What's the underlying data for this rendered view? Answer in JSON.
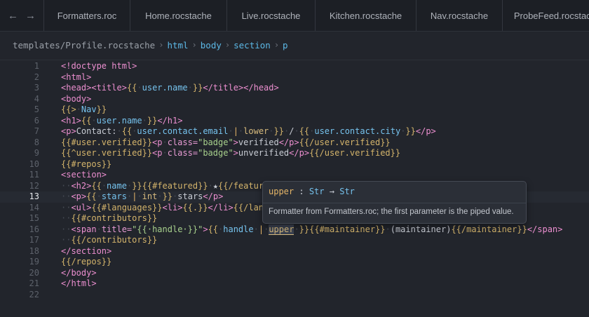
{
  "nav": {
    "back_icon": "←",
    "forward_icon": "→"
  },
  "tabs": [
    {
      "label": "Formatters.roc"
    },
    {
      "label": "Home.rocstache"
    },
    {
      "label": "Live.rocstache"
    },
    {
      "label": "Kitchen.rocstache"
    },
    {
      "label": "Nav.rocstache"
    },
    {
      "label": "ProbeFeed.rocstache"
    }
  ],
  "breadcrumb": {
    "path": "templates/Profile.rocstache",
    "sep": "›",
    "segments": [
      "html",
      "body",
      "section",
      "p"
    ]
  },
  "editor": {
    "current_line": 13,
    "lines": [
      [
        [
          "<!doctype html>",
          "tag"
        ]
      ],
      [
        [
          "<html>",
          "tag"
        ]
      ],
      [
        [
          "<head>",
          "tag"
        ],
        [
          "<title>",
          "tag"
        ],
        [
          "{{",
          "br"
        ],
        [
          "·",
          "ws"
        ],
        [
          "user.name",
          "var"
        ],
        [
          "·",
          "ws"
        ],
        [
          "}}",
          "br"
        ],
        [
          "</title>",
          "tag"
        ],
        [
          "</head>",
          "tag"
        ]
      ],
      [
        [
          "<body>",
          "tag"
        ]
      ],
      [
        [
          "{{>",
          "br"
        ],
        [
          "·",
          "ws"
        ],
        [
          "Nav",
          "var"
        ],
        [
          "}}",
          "br"
        ]
      ],
      [
        [
          "<h1>",
          "tag"
        ],
        [
          "{{",
          "br"
        ],
        [
          "·",
          "ws"
        ],
        [
          "user.name",
          "var"
        ],
        [
          "·",
          "ws"
        ],
        [
          "}}",
          "br"
        ],
        [
          "</h1>",
          "tag"
        ]
      ],
      [
        [
          "<p>",
          "tag"
        ],
        [
          "Contact:",
          "txt"
        ],
        [
          "·",
          "ws"
        ],
        [
          "{{",
          "br"
        ],
        [
          "·",
          "ws"
        ],
        [
          "user.contact.email",
          "var"
        ],
        [
          "·",
          "ws"
        ],
        [
          "|",
          "fmt"
        ],
        [
          "·",
          "ws"
        ],
        [
          "lower",
          "kw"
        ],
        [
          "·",
          "ws"
        ],
        [
          "}}",
          "br"
        ],
        [
          "·",
          "ws"
        ],
        [
          "/",
          "txt"
        ],
        [
          "·",
          "ws"
        ],
        [
          "{{",
          "br"
        ],
        [
          "·",
          "ws"
        ],
        [
          "user.contact.city",
          "var"
        ],
        [
          "·",
          "ws"
        ],
        [
          "}}",
          "br"
        ],
        [
          "</p>",
          "tag"
        ]
      ],
      [
        [
          "{{#user.verified}}",
          "br"
        ],
        [
          "<p",
          "tag"
        ],
        [
          "·",
          "ws"
        ],
        [
          "class=",
          "attr"
        ],
        [
          "\"badge\"",
          "str"
        ],
        [
          ">",
          "tag"
        ],
        [
          "verified",
          "txt"
        ],
        [
          "</p>",
          "tag"
        ],
        [
          "{{/user.verified}}",
          "br"
        ]
      ],
      [
        [
          "{{^user.verified}}",
          "br"
        ],
        [
          "<p",
          "tag"
        ],
        [
          "·",
          "ws"
        ],
        [
          "class=",
          "attr"
        ],
        [
          "\"badge\"",
          "str"
        ],
        [
          ">",
          "tag"
        ],
        [
          "unverified",
          "txt"
        ],
        [
          "</p>",
          "tag"
        ],
        [
          "{{/user.verified}}",
          "br"
        ]
      ],
      [
        [
          "{{#repos}}",
          "br"
        ]
      ],
      [
        [
          "<section>",
          "tag"
        ]
      ],
      [
        [
          "··",
          "ws"
        ],
        [
          "<h2>",
          "tag"
        ],
        [
          "{{",
          "br"
        ],
        [
          "·",
          "ws"
        ],
        [
          "name",
          "var"
        ],
        [
          "·",
          "ws"
        ],
        [
          "}}",
          "br"
        ],
        [
          "{{#featured}}",
          "br"
        ],
        [
          "·",
          "ws"
        ],
        [
          "★",
          "txt"
        ],
        [
          "{{/feature",
          "br"
        ]
      ],
      [
        [
          "··",
          "ws"
        ],
        [
          "<p>",
          "tag"
        ],
        [
          "{{",
          "br"
        ],
        [
          "·",
          "ws"
        ],
        [
          "stars",
          "var"
        ],
        [
          "·",
          "ws"
        ],
        [
          "|",
          "fmt"
        ],
        [
          "·",
          "ws"
        ],
        [
          "int",
          "kw"
        ],
        [
          "·",
          "ws"
        ],
        [
          "}}",
          "br"
        ],
        [
          "·",
          "ws"
        ],
        [
          "stars",
          "txt"
        ],
        [
          "</p>",
          "tag"
        ]
      ],
      [
        [
          "··",
          "ws"
        ],
        [
          "<ul>",
          "tag"
        ],
        [
          "{{#languages}}",
          "br"
        ],
        [
          "<li>",
          "tag"
        ],
        [
          "{{.}}",
          "br"
        ],
        [
          "</li>",
          "tag"
        ],
        [
          "{{/lang",
          "br"
        ]
      ],
      [
        [
          "··",
          "ws"
        ],
        [
          "{{#contributors}}",
          "br"
        ]
      ],
      [
        [
          "··",
          "ws"
        ],
        [
          "<span",
          "tag"
        ],
        [
          "·",
          "ws"
        ],
        [
          "title=",
          "attr"
        ],
        [
          "\"{{·handle·}}\"",
          "str"
        ],
        [
          ">",
          "tag"
        ],
        [
          "{{",
          "br"
        ],
        [
          "·",
          "ws"
        ],
        [
          "handle",
          "var"
        ],
        [
          "·",
          "ws"
        ],
        [
          "|",
          "fmt"
        ],
        [
          "·",
          "ws"
        ],
        [
          "upper",
          "kwhl"
        ],
        [
          "·",
          "ws"
        ],
        [
          "}}",
          "br"
        ],
        [
          "{{#maintainer}}",
          "br"
        ],
        [
          "·",
          "ws"
        ],
        [
          "(maintainer)",
          "txt"
        ],
        [
          "{{/maintainer}}",
          "br"
        ],
        [
          "</span>",
          "tag"
        ]
      ],
      [
        [
          "··",
          "ws"
        ],
        [
          "{{/contributors}}",
          "br"
        ]
      ],
      [
        [
          "</section>",
          "tag"
        ]
      ],
      [
        [
          "{{/repos}}",
          "br"
        ]
      ],
      [
        [
          "</body>",
          "tag"
        ]
      ],
      [
        [
          "</html>",
          "tag"
        ]
      ],
      []
    ]
  },
  "tooltip": {
    "name": "upper",
    "colon": ":",
    "input_type": "Str",
    "arrow": "→",
    "output_type": "Str",
    "doc": "Formatter from Formatters.roc; the first parameter is the piped value."
  }
}
